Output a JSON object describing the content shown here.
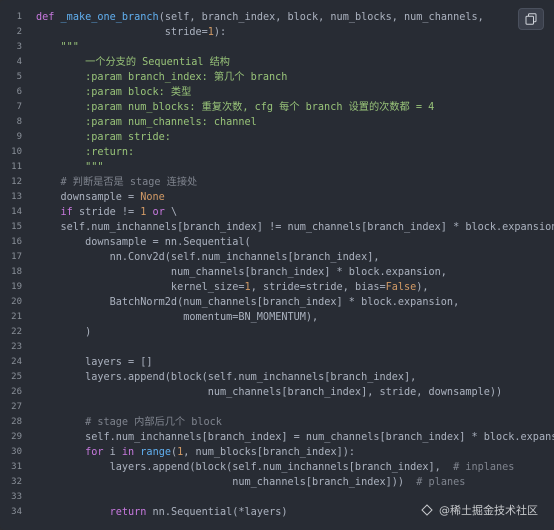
{
  "lines": [
    {
      "n": "1",
      "segs": [
        [
          "kw",
          "def "
        ],
        [
          "fn",
          "_make_one_branch"
        ],
        [
          "",
          "(self, branch_index, block, num_blocks, num_channels,"
        ]
      ]
    },
    {
      "n": "2",
      "segs": [
        [
          "",
          "                     stride="
        ],
        [
          "num",
          "1"
        ],
        [
          "",
          "):"
        ]
      ]
    },
    {
      "n": "3",
      "segs": [
        [
          "str",
          "    \"\"\""
        ]
      ]
    },
    {
      "n": "4",
      "segs": [
        [
          "str",
          "        一个分支的 Sequential 结构"
        ]
      ]
    },
    {
      "n": "5",
      "segs": [
        [
          "str",
          "        :param branch_index: 第几个 branch"
        ]
      ]
    },
    {
      "n": "6",
      "segs": [
        [
          "str",
          "        :param block: 类型"
        ]
      ]
    },
    {
      "n": "7",
      "segs": [
        [
          "str",
          "        :param num_blocks: 重复次数, cfg 每个 branch 设置的次数都 = 4"
        ]
      ]
    },
    {
      "n": "8",
      "segs": [
        [
          "str",
          "        :param num_channels: channel"
        ]
      ]
    },
    {
      "n": "9",
      "segs": [
        [
          "str",
          "        :param stride:"
        ]
      ]
    },
    {
      "n": "10",
      "segs": [
        [
          "str",
          "        :return:"
        ]
      ]
    },
    {
      "n": "11",
      "segs": [
        [
          "str",
          "        \"\"\""
        ]
      ]
    },
    {
      "n": "12",
      "segs": [
        [
          "cm",
          "    # 判断是否是 stage 连接处"
        ]
      ]
    },
    {
      "n": "13",
      "segs": [
        [
          "",
          "    downsample = "
        ],
        [
          "num",
          "None"
        ]
      ]
    },
    {
      "n": "14",
      "segs": [
        [
          "kw",
          "    if "
        ],
        [
          "",
          "stride != "
        ],
        [
          "num",
          "1"
        ],
        [
          "kw",
          " or "
        ],
        [
          "",
          "\\"
        ]
      ]
    },
    {
      "n": "15",
      "segs": [
        [
          "",
          "    self.num_inchannels[branch_index] != num_channels[branch_index] * block.expansion:"
        ]
      ]
    },
    {
      "n": "16",
      "segs": [
        [
          "",
          "        downsample = nn.Sequential("
        ]
      ]
    },
    {
      "n": "17",
      "segs": [
        [
          "",
          "            nn.Conv2d(self.num_inchannels[branch_index],"
        ]
      ]
    },
    {
      "n": "18",
      "segs": [
        [
          "",
          "                      num_channels[branch_index] * block.expansion,"
        ]
      ]
    },
    {
      "n": "19",
      "segs": [
        [
          "",
          "                      kernel_size="
        ],
        [
          "num",
          "1"
        ],
        [
          "",
          ", stride=stride, bias="
        ],
        [
          "num",
          "False"
        ],
        [
          "",
          "),"
        ]
      ]
    },
    {
      "n": "20",
      "segs": [
        [
          "",
          "            BatchNorm2d(num_channels[branch_index] * block.expansion,"
        ]
      ]
    },
    {
      "n": "21",
      "segs": [
        [
          "",
          "                        momentum=BN_MOMENTUM),"
        ]
      ]
    },
    {
      "n": "22",
      "segs": [
        [
          "",
          "        )"
        ]
      ]
    },
    {
      "n": "23",
      "segs": [
        [
          "",
          ""
        ]
      ]
    },
    {
      "n": "24",
      "segs": [
        [
          "",
          "        layers = []"
        ]
      ]
    },
    {
      "n": "25",
      "segs": [
        [
          "",
          "        layers.append(block(self.num_inchannels[branch_index],"
        ]
      ]
    },
    {
      "n": "26",
      "segs": [
        [
          "",
          "                            num_channels[branch_index], stride, downsample))"
        ]
      ]
    },
    {
      "n": "27",
      "segs": [
        [
          "",
          ""
        ]
      ]
    },
    {
      "n": "28",
      "segs": [
        [
          "cm",
          "        # stage 内部后几个 block"
        ]
      ]
    },
    {
      "n": "29",
      "segs": [
        [
          "",
          "        self.num_inchannels[branch_index] = num_channels[branch_index] * block.expansion"
        ]
      ]
    },
    {
      "n": "30",
      "segs": [
        [
          "kw",
          "        for "
        ],
        [
          "",
          "i "
        ],
        [
          "kw",
          "in "
        ],
        [
          "fn",
          "range"
        ],
        [
          "",
          "("
        ],
        [
          "num",
          "1"
        ],
        [
          "",
          ", num_blocks[branch_index]):"
        ]
      ]
    },
    {
      "n": "31",
      "segs": [
        [
          "",
          "            layers.append(block(self.num_inchannels[branch_index],  "
        ],
        [
          "cm",
          "# inplanes"
        ]
      ]
    },
    {
      "n": "32",
      "segs": [
        [
          "",
          "                                num_channels[branch_index]))  "
        ],
        [
          "cm",
          "# planes"
        ]
      ]
    },
    {
      "n": "33",
      "segs": [
        [
          "",
          ""
        ]
      ]
    },
    {
      "n": "34",
      "segs": [
        [
          "kw",
          "            return "
        ],
        [
          "",
          "nn.Sequential(*layers)"
        ]
      ]
    }
  ],
  "watermark": "@稀土掘金技术社区",
  "icons": {
    "copy": "copy-icon",
    "watermark": "leaf-icon"
  }
}
